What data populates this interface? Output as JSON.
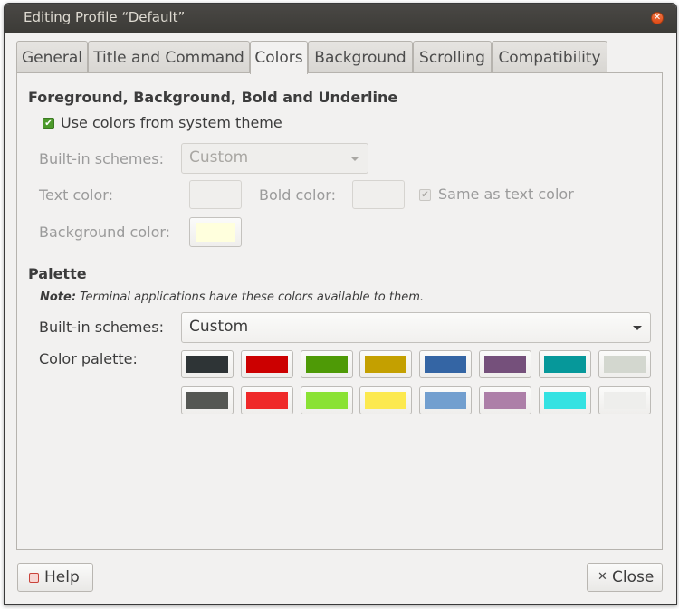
{
  "window": {
    "title": "Editing Profile “Default”"
  },
  "tabs": [
    {
      "label": "General"
    },
    {
      "label": "Title and Command"
    },
    {
      "label": "Colors"
    },
    {
      "label": "Background"
    },
    {
      "label": "Scrolling"
    },
    {
      "label": "Compatibility"
    }
  ],
  "fg_section": {
    "heading": "Foreground, Background, Bold and Underline",
    "use_system_label": "Use colors from system theme",
    "use_system_checked": true,
    "schemes_label": "Built-in schemes:",
    "schemes_value": "Custom",
    "text_color_label": "Text color:",
    "bold_color_label": "Bold color:",
    "same_as_text_label": "Same as text color",
    "same_as_text_checked": true,
    "bg_color_label": "Background color:",
    "bg_color": "#ffffdd"
  },
  "palette_section": {
    "heading": "Palette",
    "note_bold": "Note:",
    "note_text": " Terminal applications have these colors available to them.",
    "schemes_label": "Built-in schemes:",
    "schemes_value": "Custom",
    "palette_label": "Color palette:",
    "colors": [
      "#2e3436",
      "#cc0000",
      "#4e9a06",
      "#c4a000",
      "#3465a4",
      "#75507b",
      "#06989a",
      "#d3d7cf",
      "#555753",
      "#ef2929",
      "#8ae234",
      "#fce94f",
      "#729fcf",
      "#ad7fa8",
      "#34e2e2",
      "#eeeeec"
    ]
  },
  "footer": {
    "help_label": "Help",
    "close_label": "Close"
  }
}
